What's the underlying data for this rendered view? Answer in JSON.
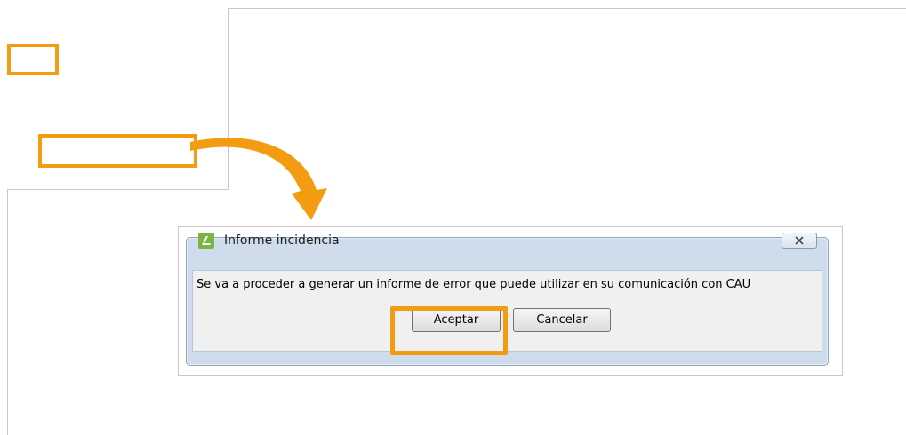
{
  "colors": {
    "highlight": "#f39c12",
    "dialog_frame": "#cfdceb",
    "dialog_body": "#f0f0f0",
    "frame_line": "#c8c8c8"
  },
  "dialog": {
    "title": "Informe incidencia",
    "app_icon": "app-logo-icon",
    "close_icon": "close-icon",
    "message": "Se va a proceder a generar un informe de error que puede utilizar en su comunicación con CAU",
    "buttons": {
      "accept_label": "Aceptar",
      "cancel_label": "Cancelar"
    }
  },
  "annotations": {
    "arrow_icon": "curved-arrow-icon"
  }
}
